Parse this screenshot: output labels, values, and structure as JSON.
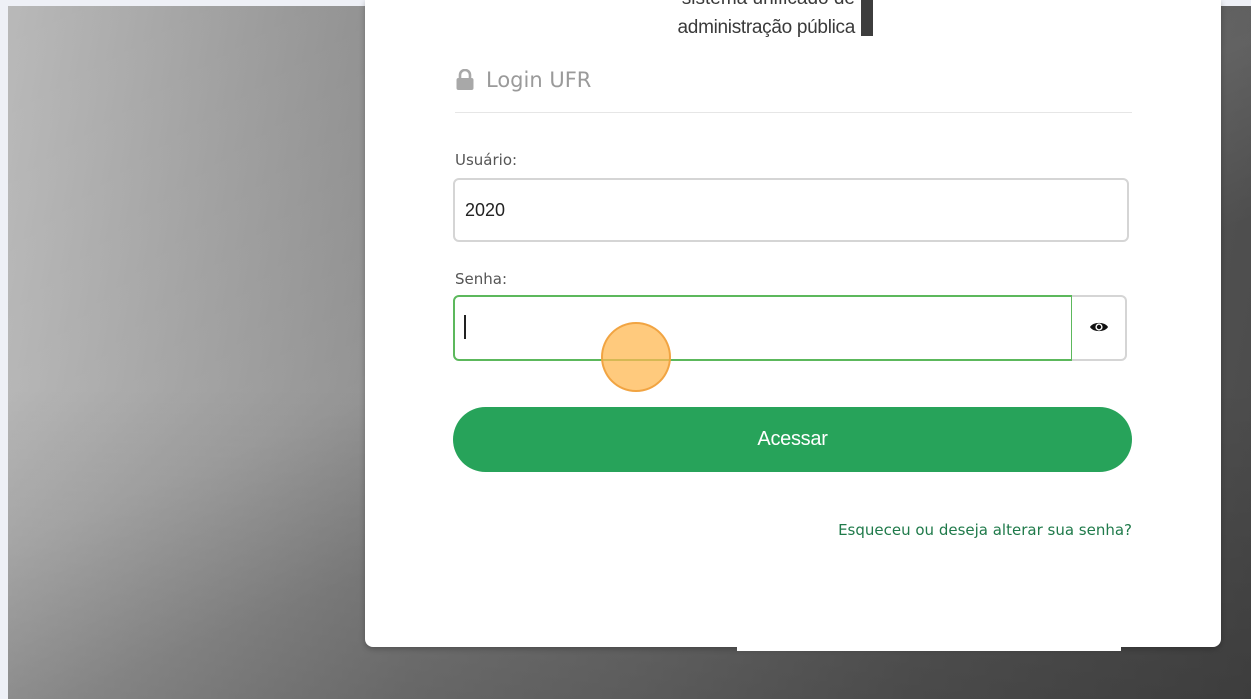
{
  "brand": {
    "line1": "sistema unificado de",
    "line2": "administração pública"
  },
  "login": {
    "title": "Login UFR",
    "user_label": "Usuário:",
    "user_value": "2020",
    "password_label": "Senha:",
    "password_value": "",
    "submit_label": "Acessar",
    "forgot_link": "Esqueceu ou deseja alterar sua senha?"
  },
  "icons": {
    "lock": "lock-icon",
    "eye": "eye-icon"
  },
  "colors": {
    "primary_button": "#27a35a",
    "focus_border": "#5cb85c",
    "link": "#1f7a4a",
    "click_marker": "#ffb852"
  }
}
